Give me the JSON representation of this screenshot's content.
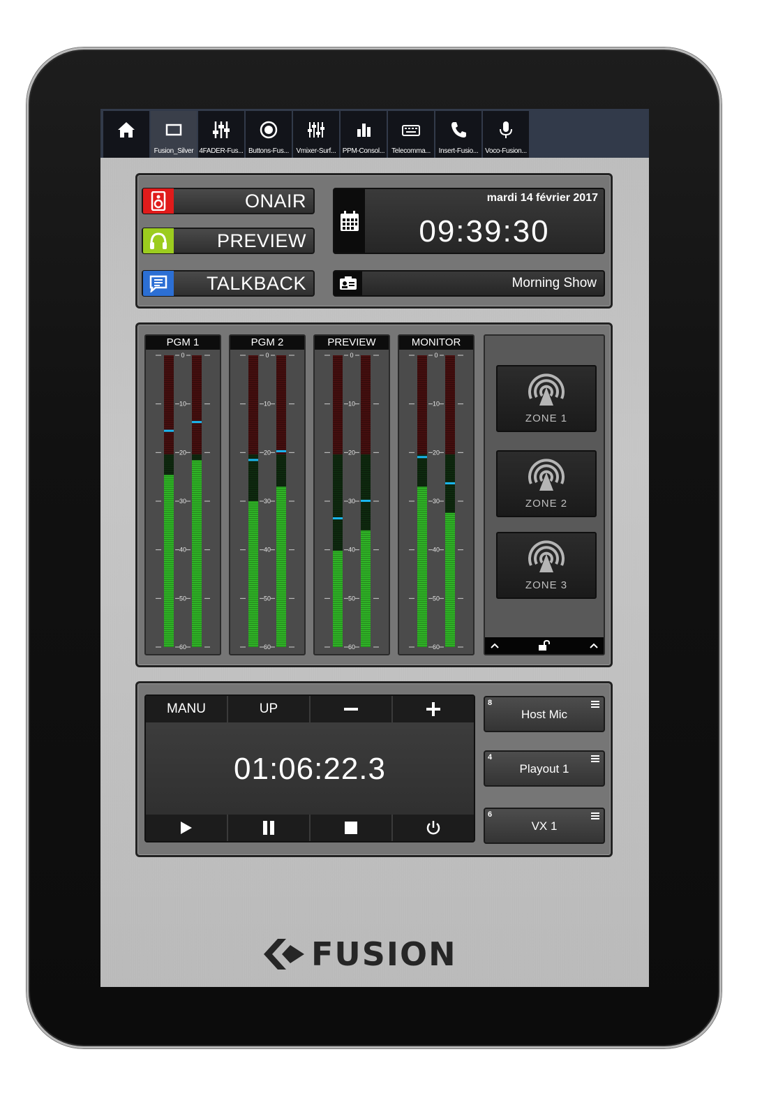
{
  "nav": {
    "tabs": [
      {
        "icon": "home-icon",
        "label": ""
      },
      {
        "icon": "window-icon",
        "label": "Fusion_Silver"
      },
      {
        "icon": "faders-icon",
        "label": "4FADER-Fus..."
      },
      {
        "icon": "record-icon",
        "label": "Buttons-Fus..."
      },
      {
        "icon": "mixer-icon",
        "label": "Vmixer-Surf..."
      },
      {
        "icon": "bar-chart-icon",
        "label": "PPM-Consol..."
      },
      {
        "icon": "keyboard-icon",
        "label": "Telecomma..."
      },
      {
        "icon": "phone-icon",
        "label": "Insert-Fusio..."
      },
      {
        "icon": "microphone-icon",
        "label": "Voco-Fusion..."
      }
    ]
  },
  "status": {
    "modes": [
      {
        "label": "ONAIR",
        "icon": "speaker-icon",
        "color": "#e01b1b"
      },
      {
        "label": "PREVIEW",
        "icon": "headphones-icon",
        "color": "#9ccc1f"
      },
      {
        "label": "TALKBACK",
        "icon": "chat-icon",
        "color": "#2c6fd4"
      }
    ],
    "date": "mardi 14 février 2017",
    "time": "09:39:30",
    "show": "Morning Show"
  },
  "meters": {
    "scale": [
      "0",
      "10",
      "20",
      "30",
      "40",
      "50",
      "60"
    ],
    "channels": [
      {
        "label": "PGM 1",
        "left_level": 0.59,
        "right_level": 0.64,
        "left_peak": 0.74,
        "right_peak": 0.77
      },
      {
        "label": "PGM 2",
        "left_level": 0.5,
        "right_level": 0.55,
        "left_peak": 0.64,
        "right_peak": 0.67
      },
      {
        "label": "PREVIEW",
        "left_level": 0.33,
        "right_level": 0.4,
        "left_peak": 0.44,
        "right_peak": 0.5
      },
      {
        "label": "MONITOR",
        "left_level": 0.55,
        "right_level": 0.46,
        "left_peak": 0.65,
        "right_peak": 0.56
      }
    ]
  },
  "zones": [
    {
      "label": "ZONE 1"
    },
    {
      "label": "ZONE 2"
    },
    {
      "label": "ZONE 3"
    }
  ],
  "timer": {
    "top_buttons": [
      "MANU",
      "UP",
      "−",
      "+"
    ],
    "value": "01:06:22.3",
    "transport": [
      "play-icon",
      "pause-icon",
      "stop-icon",
      "power-icon"
    ]
  },
  "sources": [
    {
      "number": "8",
      "name": "Host Mic"
    },
    {
      "number": "4",
      "name": "Playout 1"
    },
    {
      "number": "6",
      "name": "VX 1"
    }
  ],
  "brand": {
    "name": "FUSION"
  }
}
